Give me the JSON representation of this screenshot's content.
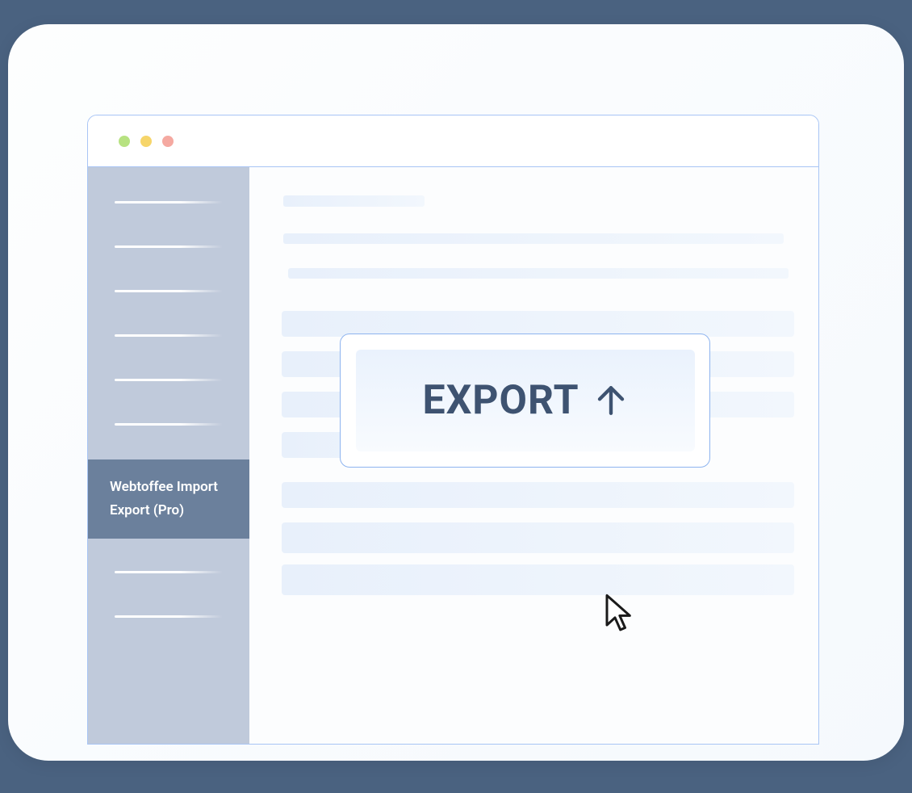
{
  "sidebar": {
    "active_item_label": "Webtoffee Import Export (Pro)"
  },
  "main": {
    "export_button_label": "EXPORT"
  },
  "colors": {
    "accent_border": "#8eb4ef",
    "sidebar_bg": "#c0cadb",
    "sidebar_active_bg": "#6b809c",
    "text_dark": "#3e5371"
  }
}
